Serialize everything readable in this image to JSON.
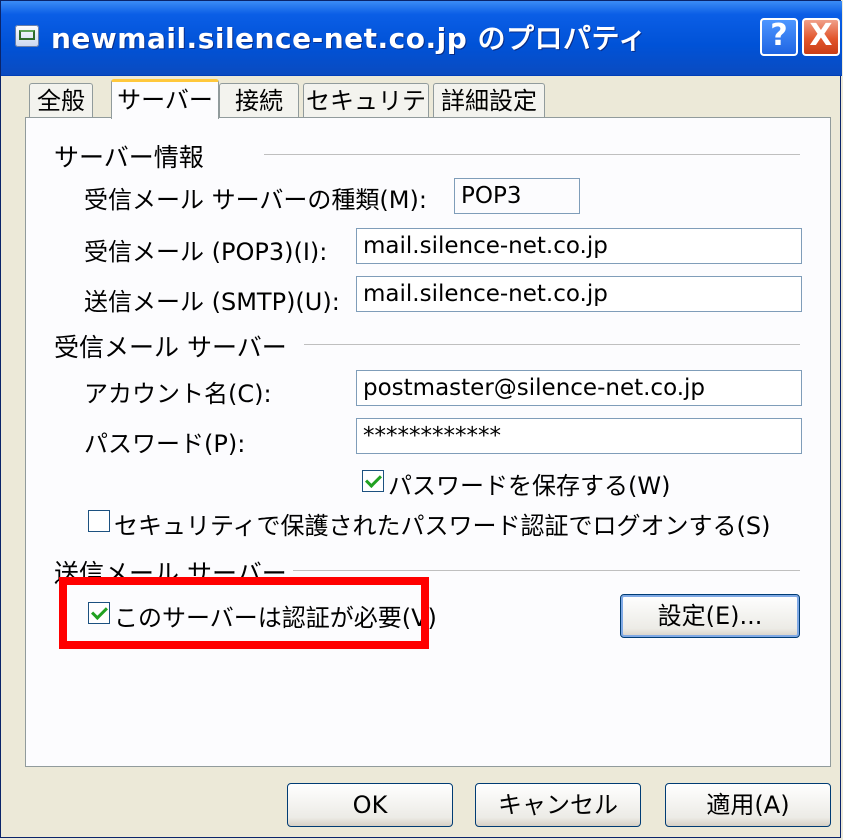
{
  "window": {
    "title": "newmail.silence-net.co.jp のプロパティ",
    "help_label": "?",
    "close_label": "X"
  },
  "tabs": [
    "全般",
    "サーバー",
    "接続",
    "セキュリティ",
    "詳細設定"
  ],
  "active_tab": "サーバー",
  "server_info": {
    "heading": "サーバー情報",
    "type_label": "受信メール サーバーの種類(M):",
    "type_value": "POP3",
    "incoming_label": "受信メール (POP3)(I):",
    "incoming_value": "mail.silence-net.co.jp",
    "outgoing_label": "送信メール (SMTP)(U):",
    "outgoing_value": "mail.silence-net.co.jp"
  },
  "incoming_server": {
    "heading": "受信メール サーバー",
    "account_label": "アカウント名(C):",
    "account_value": "postmaster@silence-net.co.jp",
    "password_label": "パスワード(P):",
    "password_value": "************",
    "remember_password_label": "パスワードを保存する(W)",
    "remember_password_checked": true,
    "spa_label": "セキュリティで保護されたパスワード認証でログオンする(S)",
    "spa_checked": false
  },
  "outgoing_server": {
    "heading": "送信メール サーバー",
    "auth_required_label": "このサーバーは認証が必要(V)",
    "auth_required_checked": true,
    "settings_button": "設定(E)..."
  },
  "footer": {
    "ok": "OK",
    "cancel": "キャンセル",
    "apply": "適用(A)"
  },
  "colors": {
    "titlebar": "#0052d7",
    "highlight_frame": "#ff0000",
    "check_mark": "#21a121"
  }
}
